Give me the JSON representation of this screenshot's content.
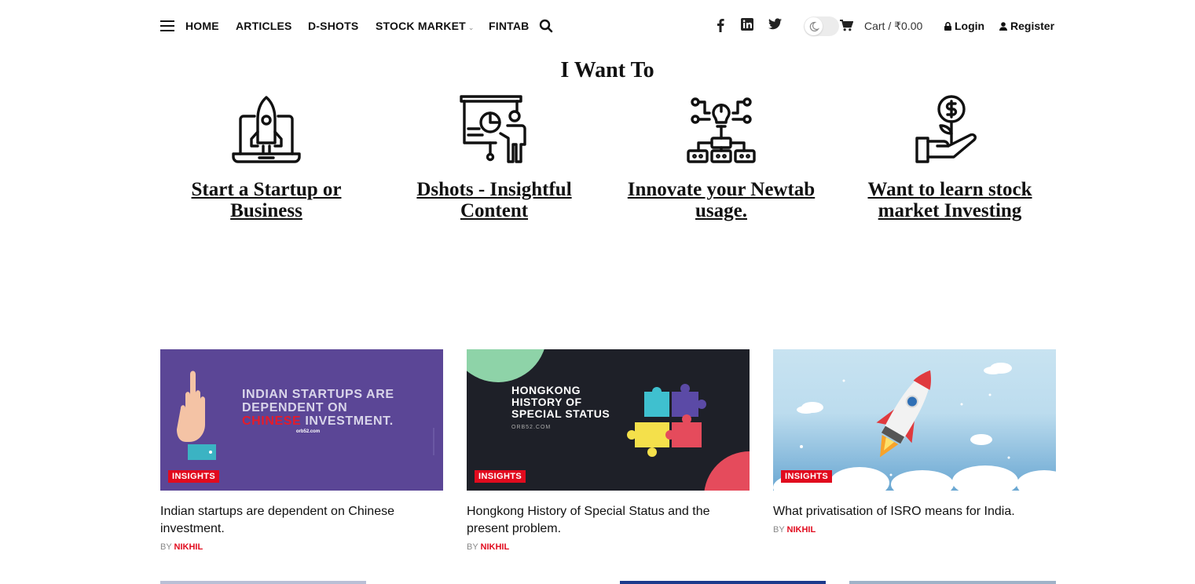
{
  "nav": {
    "items": [
      {
        "label": "HOME"
      },
      {
        "label": "ARTICLES"
      },
      {
        "label": "D-SHOTS"
      },
      {
        "label": "STOCK MARKET",
        "caret": "⌄"
      },
      {
        "label": "FINTAB"
      }
    ],
    "social": [
      "facebook-icon",
      "linkedin-icon",
      "twitter-icon"
    ],
    "cart_label": "Cart / ₹0.00",
    "login_label": "Login",
    "register_label": "Register"
  },
  "hero": {
    "heading": "I Want To",
    "options": [
      {
        "label": "Start a Startup or Business",
        "icon": "rocket-laptop-icon"
      },
      {
        "label": "Dshots - Insightful Content",
        "icon": "presentation-icon"
      },
      {
        "label": "Innovate your Newtab usage.",
        "icon": "idea-network-icon"
      },
      {
        "label": "Want to learn stock market Investing",
        "icon": "money-hand-icon"
      }
    ]
  },
  "articles": [
    {
      "category": "INSIGHTS",
      "title": "Indian startups are dependent on Chinese investment.",
      "by": "BY",
      "author": "NIKHIL",
      "image_text": {
        "line1": "INDIAN STARTUPS ARE",
        "line2": "DEPENDENT ON",
        "line3_red": "CHINESE",
        "line3_rest": " INVESTMENT.",
        "site": "orb52.com"
      }
    },
    {
      "category": "INSIGHTS",
      "title": "Hongkong History of Special Status and the present problem.",
      "by": "BY",
      "author": "NIKHIL",
      "image_text": {
        "line1": "HONGKONG",
        "line2": "HISTORY OF",
        "line3": "SPECIAL STATUS",
        "site": "ORB52.COM"
      }
    },
    {
      "category": "INSIGHTS",
      "title": "What privatisation of ISRO means for India.",
      "by": "BY",
      "author": "NIKHIL"
    }
  ],
  "colors": {
    "accent": "#e10b1e",
    "purple": "#5b4696",
    "dark": "#1e2028",
    "sky": "#c5e0f0"
  }
}
